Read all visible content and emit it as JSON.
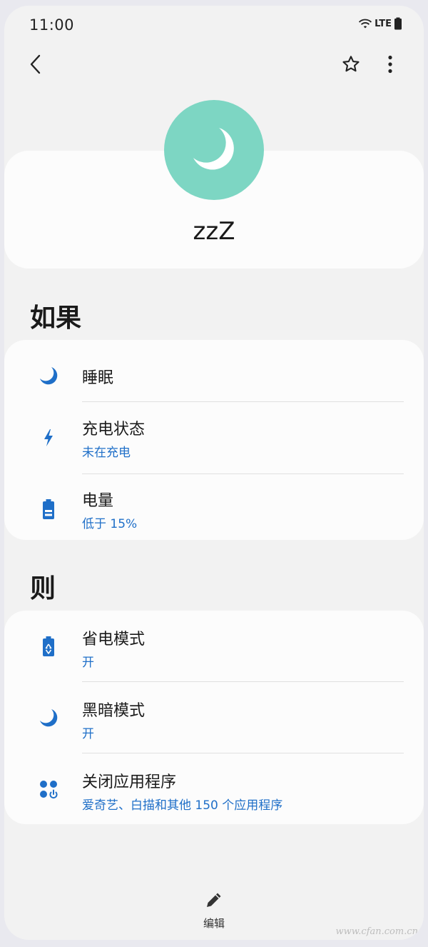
{
  "status_bar": {
    "time": "11:00",
    "network": "LTE"
  },
  "toolbar": {
    "back_icon": "chevron-left-icon",
    "favorite_icon": "star-outline-icon",
    "more_icon": "more-vertical-icon"
  },
  "routine": {
    "name": "zzZ",
    "icon": "moon-icon",
    "icon_color": "#7dd6c3"
  },
  "conditions": {
    "title": "如果",
    "items": [
      {
        "icon": "moon-icon",
        "title": "睡眠",
        "subtitle": ""
      },
      {
        "icon": "lightning-icon",
        "title": "充电状态",
        "subtitle": "未在充电"
      },
      {
        "icon": "battery-icon",
        "title": "电量",
        "subtitle": "低于 15%"
      }
    ]
  },
  "actions": {
    "title": "则",
    "items": [
      {
        "icon": "power-saving-icon",
        "title": "省电模式",
        "subtitle": "开"
      },
      {
        "icon": "moon-icon",
        "title": "黑暗模式",
        "subtitle": "开"
      },
      {
        "icon": "close-apps-icon",
        "title": "关闭应用程序",
        "subtitle": "爱奇艺、白描和其他 150 个应用程序"
      }
    ]
  },
  "bottom": {
    "edit_label": "编辑",
    "edit_icon": "pencil-icon"
  },
  "watermark": "www.cfan.com.cn",
  "colors": {
    "accent_blue": "#1f6fc8",
    "background": "#f2f2f2",
    "card": "#fcfcfc"
  }
}
